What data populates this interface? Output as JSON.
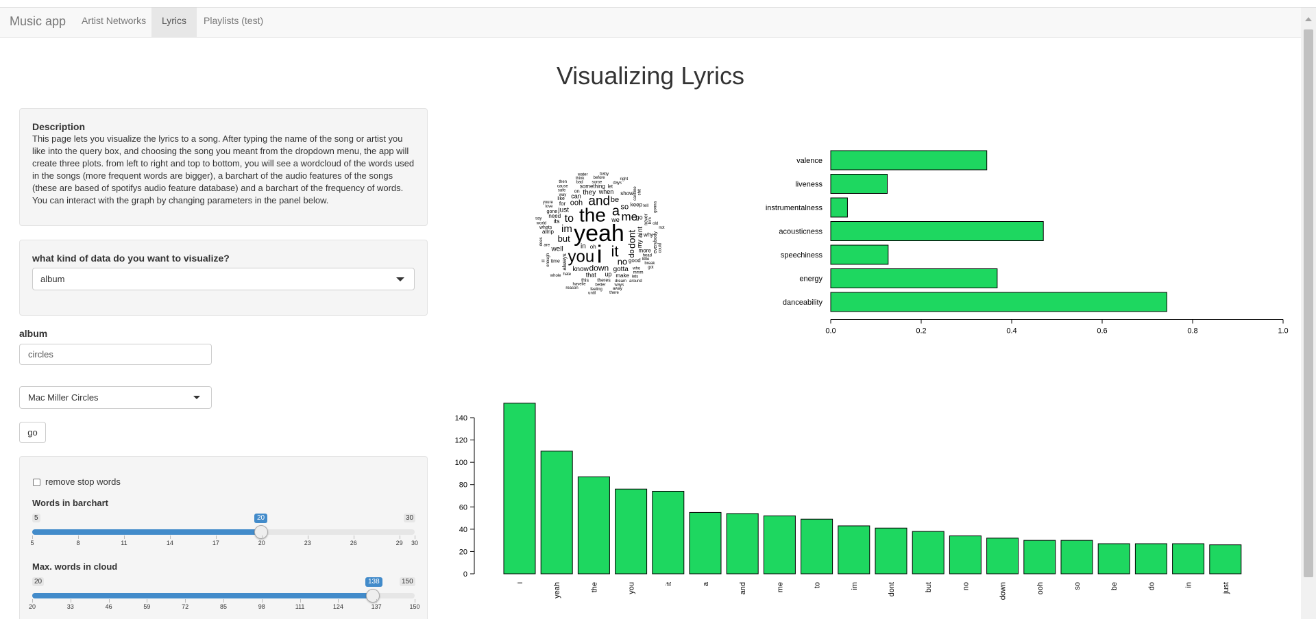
{
  "navbar": {
    "brand": "Music app",
    "tabs": [
      {
        "label": "Artist Networks",
        "active": false
      },
      {
        "label": "Lyrics",
        "active": true
      },
      {
        "label": "Playlists (test)",
        "active": false
      }
    ]
  },
  "page": {
    "title": "Visualizing Lyrics"
  },
  "description": {
    "title": "Description",
    "text": "This page lets you visualize the lyrics to a song. After typing the name of the song or artist you like into the query box, and choosing the song you meant from the dropdown menu, the app will create three plots. from left to right and top to bottom, you will see a wordcloud of the words used in the songs (more frequent words are bigger), a barchart of the audio features of the songs (these are based of spotifys audio feature database) and a barchart of the frequency of words. You can interact with the graph by changing parameters in the panel below."
  },
  "data_type": {
    "label": "what kind of data do you want to visualize?",
    "selected": "album"
  },
  "album": {
    "label": "album",
    "value": "circles"
  },
  "album_select": {
    "selected": "Mac Miller Circles"
  },
  "go_button": {
    "label": "go"
  },
  "options": {
    "stopwords_label": "remove stop words",
    "stopwords_checked": false,
    "words_barchart": {
      "label": "Words in barchart",
      "min": 5,
      "max": 30,
      "value": 20,
      "ticks": [
        5,
        8,
        11,
        14,
        17,
        20,
        23,
        26,
        29,
        30
      ]
    },
    "words_cloud": {
      "label": "Max. words in cloud",
      "min": 20,
      "max": 150,
      "value": 138,
      "ticks": [
        20,
        33,
        46,
        59,
        72,
        85,
        98,
        111,
        124,
        137,
        150
      ]
    }
  },
  "wordcloud": {
    "words": [
      {
        "text": "yeah",
        "size": 34
      },
      {
        "text": "the",
        "size": 28
      },
      {
        "text": "i",
        "size": 36
      },
      {
        "text": "you",
        "size": 24
      },
      {
        "text": "it",
        "size": 22
      },
      {
        "text": "a",
        "size": 20
      },
      {
        "text": "and",
        "size": 19
      },
      {
        "text": "me",
        "size": 17
      },
      {
        "text": "to",
        "size": 16
      },
      {
        "text": "im",
        "size": 15
      },
      {
        "text": "dont",
        "size": 14
      },
      {
        "text": "but",
        "size": 13
      },
      {
        "text": "no",
        "size": 13
      },
      {
        "text": "down",
        "size": 12
      },
      {
        "text": "ooh",
        "size": 11
      },
      {
        "text": "so",
        "size": 11
      },
      {
        "text": "be",
        "size": 11
      },
      {
        "text": "do",
        "size": 11
      },
      {
        "text": "in",
        "size": 10
      },
      {
        "text": "just",
        "size": 10
      },
      {
        "text": "know",
        "size": 10
      },
      {
        "text": "well",
        "size": 10
      },
      {
        "text": "they",
        "size": 10
      },
      {
        "text": "gotta",
        "size": 10
      },
      {
        "text": "aint",
        "size": 10
      },
      {
        "text": "we",
        "size": 9
      },
      {
        "text": "its",
        "size": 9
      },
      {
        "text": "go",
        "size": 9
      },
      {
        "text": "when",
        "size": 9
      },
      {
        "text": "that",
        "size": 9
      },
      {
        "text": "can",
        "size": 9
      },
      {
        "text": "my",
        "size": 9
      },
      {
        "text": "up",
        "size": 9
      },
      {
        "text": "good",
        "size": 8
      },
      {
        "text": "something",
        "size": 8
      },
      {
        "text": "allrip",
        "size": 8
      },
      {
        "text": "keep",
        "size": 8
      },
      {
        "text": "need",
        "size": 8
      },
      {
        "text": "always",
        "size": 8
      },
      {
        "text": "for",
        "size": 8
      },
      {
        "text": "more",
        "size": 8
      },
      {
        "text": "show",
        "size": 8
      },
      {
        "text": "why",
        "size": 8
      },
      {
        "text": "make",
        "size": 8
      },
      {
        "text": "oh",
        "size": 8
      },
      {
        "text": "never",
        "size": 7
      },
      {
        "text": "theres",
        "size": 7
      },
      {
        "text": "on",
        "size": 7
      },
      {
        "text": "this",
        "size": 7
      },
      {
        "text": "let",
        "size": 7
      },
      {
        "text": "like",
        "size": 7
      },
      {
        "text": "time",
        "size": 7
      },
      {
        "text": "everybody",
        "size": 7
      },
      {
        "text": "whats",
        "size": 7
      },
      {
        "text": "gone",
        "size": 7
      },
      {
        "text": "head",
        "size": 6
      },
      {
        "text": "hate",
        "size": 6
      },
      {
        "text": "who",
        "size": 6
      },
      {
        "text": "some",
        "size": 6
      },
      {
        "text": "him",
        "size": 6
      },
      {
        "text": "dream",
        "size": 6
      },
      {
        "text": "better",
        "size": 6
      },
      {
        "text": "are",
        "size": 6
      },
      {
        "text": "way",
        "size": 6
      },
      {
        "text": "days",
        "size": 6
      },
      {
        "text": "tell",
        "size": 6
      },
      {
        "text": "cantline",
        "size": 6
      },
      {
        "text": "mmm",
        "size": 6
      },
      {
        "text": "havelie",
        "size": 6
      },
      {
        "text": "little",
        "size": 6
      },
      {
        "text": "love",
        "size": 6
      },
      {
        "text": "bad",
        "size": 6
      },
      {
        "text": "ways",
        "size": 6
      },
      {
        "text": "enough",
        "size": 6
      },
      {
        "text": "world",
        "size": 6
      },
      {
        "text": "safe",
        "size": 6
      },
      {
        "text": "before",
        "size": 6
      },
      {
        "text": "feeling",
        "size": 6
      },
      {
        "text": "old",
        "size": 6
      },
      {
        "text": "lets",
        "size": 6
      },
      {
        "text": "does",
        "size": 6
      },
      {
        "text": "break",
        "size": 6
      },
      {
        "text": "youre",
        "size": 6
      },
      {
        "text": "think",
        "size": 6
      },
      {
        "text": "away",
        "size": 6
      },
      {
        "text": "cause",
        "size": 6
      },
      {
        "text": "around",
        "size": 6
      },
      {
        "text": "shit",
        "size": 6
      },
      {
        "text": "whole",
        "size": 6
      },
      {
        "text": "baby",
        "size": 6
      },
      {
        "text": "right",
        "size": 6
      },
      {
        "text": "until",
        "size": 6
      },
      {
        "text": "reason",
        "size": 6
      },
      {
        "text": "say",
        "size": 6
      },
      {
        "text": "gonna",
        "size": 6
      },
      {
        "text": "water",
        "size": 6
      },
      {
        "text": "there",
        "size": 6
      },
      {
        "text": "then",
        "size": 6
      },
      {
        "text": "live",
        "size": 6
      },
      {
        "text": "only",
        "size": 6
      },
      {
        "text": "even",
        "size": 6
      },
      {
        "text": "could",
        "size": 6
      },
      {
        "text": "might",
        "size": 6
      },
      {
        "text": "what",
        "size": 6
      },
      {
        "text": "not",
        "size": 6
      },
      {
        "text": "where",
        "size": 6
      },
      {
        "text": "without",
        "size": 6
      },
      {
        "text": "got",
        "size": 6
      },
      {
        "text": "ill",
        "size": 6
      },
      {
        "text": "feel",
        "size": 6
      }
    ]
  },
  "chart_data": [
    {
      "type": "bar",
      "orientation": "horizontal",
      "categories": [
        "valence",
        "liveness",
        "instrumentalness",
        "acousticness",
        "speechiness",
        "energy",
        "danceability"
      ],
      "values": [
        0.345,
        0.125,
        0.037,
        0.47,
        0.127,
        0.368,
        0.743
      ],
      "xlim": [
        0,
        1.0
      ],
      "xticks": [
        "0.0",
        "0.2",
        "0.4",
        "0.6",
        "0.8",
        "1.0"
      ],
      "bar_color": "#1ed760",
      "grid": false
    },
    {
      "type": "bar",
      "orientation": "vertical",
      "categories": [
        "i",
        "yeah",
        "the",
        "you",
        "it",
        "a",
        "and",
        "me",
        "to",
        "im",
        "dont",
        "but",
        "no",
        "down",
        "ooh",
        "so",
        "be",
        "do",
        "in",
        "just"
      ],
      "values": [
        153,
        110,
        87,
        76,
        74,
        55,
        54,
        52,
        49,
        43,
        41,
        38,
        34,
        32,
        30,
        30,
        27,
        27,
        27,
        26
      ],
      "ylim": [
        0,
        140
      ],
      "yticks": [
        "0",
        "20",
        "40",
        "60",
        "80",
        "100",
        "120",
        "140"
      ],
      "bar_color": "#1ed760",
      "grid": false
    }
  ]
}
